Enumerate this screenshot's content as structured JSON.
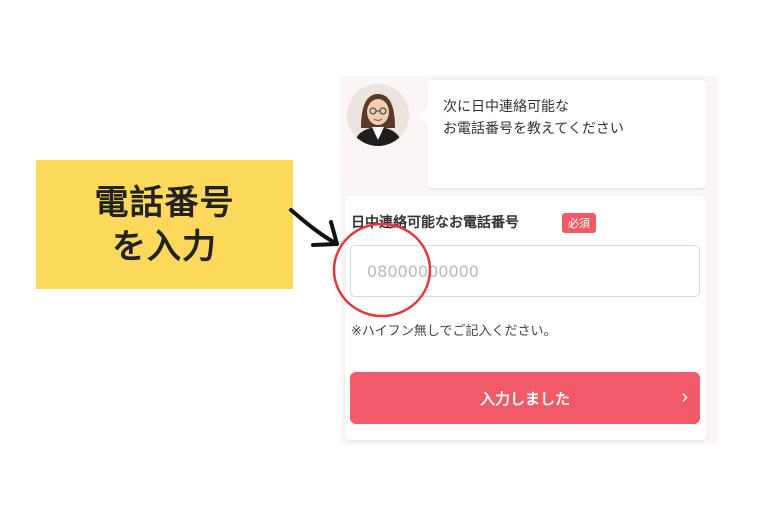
{
  "callout": {
    "line1": "電話番号",
    "line2": "を入力"
  },
  "chat": {
    "message": "次に日中連絡可能な\nお電話番号を教えてください"
  },
  "form": {
    "label": "日中連絡可能なお電話番号",
    "required_badge": "必須",
    "phone_placeholder": "08000000000",
    "note": "※ハイフン無しでご記入ください。",
    "submit_label": "入力しました"
  },
  "colors": {
    "callout_bg": "#fcd95a",
    "accent": "#f15a66",
    "highlight_ring": "#e03a3a"
  },
  "icons": {
    "arrow": "arrow-right-icon",
    "submit_chevron": "chevron-right-icon",
    "avatar": "operator-avatar"
  }
}
